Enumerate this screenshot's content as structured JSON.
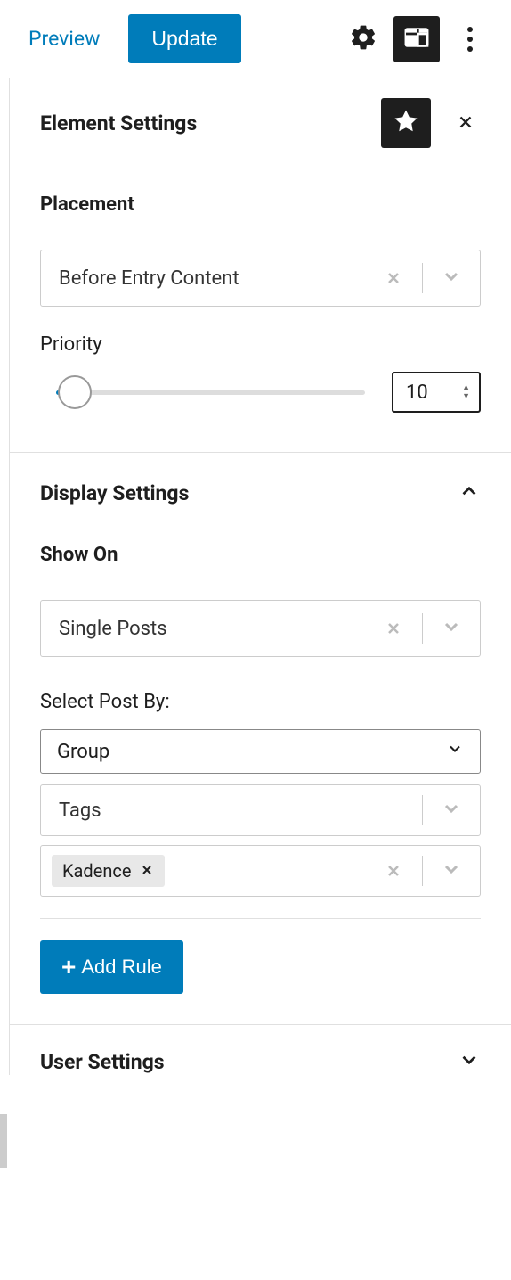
{
  "toolbar": {
    "preview_label": "Preview",
    "update_label": "Update"
  },
  "panel": {
    "title": "Element Settings"
  },
  "placement": {
    "label": "Placement",
    "selected": "Before Entry Content",
    "priority_label": "Priority",
    "priority_value": "10"
  },
  "display": {
    "title": "Display Settings",
    "show_on_label": "Show On",
    "show_on_value": "Single Posts",
    "select_post_by_label": "Select Post By:",
    "group_value": "Group",
    "tags_value": "Tags",
    "tag_chip": "Kadence",
    "add_rule_label": "Add Rule"
  },
  "user": {
    "title": "User Settings"
  }
}
